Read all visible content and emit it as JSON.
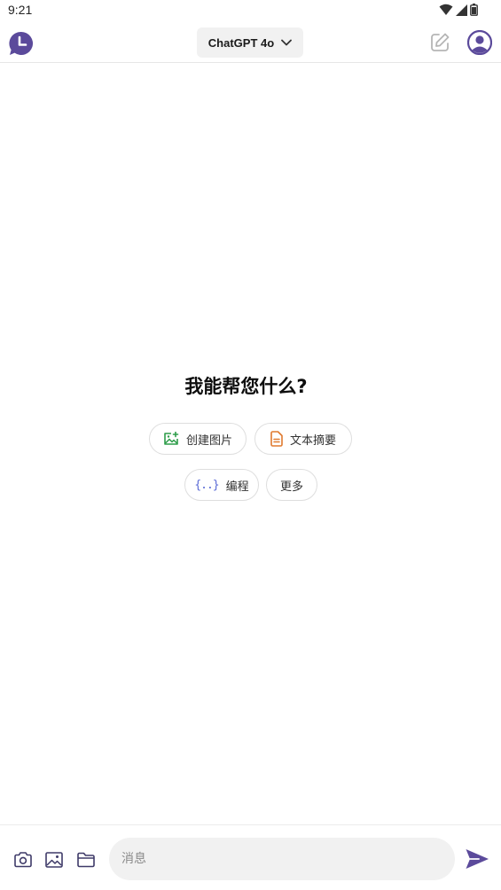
{
  "status_bar": {
    "time": "9:21"
  },
  "header": {
    "model_label": "ChatGPT 4o"
  },
  "main": {
    "title": "我能帮您什么?",
    "chips": [
      {
        "label": "创建图片",
        "icon": "image-plus-icon"
      },
      {
        "label": "文本摘要",
        "icon": "document-icon"
      },
      {
        "label": "编程",
        "icon": "code-braces-icon"
      },
      {
        "label": "更多"
      }
    ]
  },
  "composer": {
    "placeholder": "消息"
  },
  "colors": {
    "brand_purple": "#5b4a9b",
    "image_chip_green": "#2e9d4a",
    "summary_chip_orange": "#e07a2f",
    "code_chip_blue": "#5b6bd6"
  }
}
